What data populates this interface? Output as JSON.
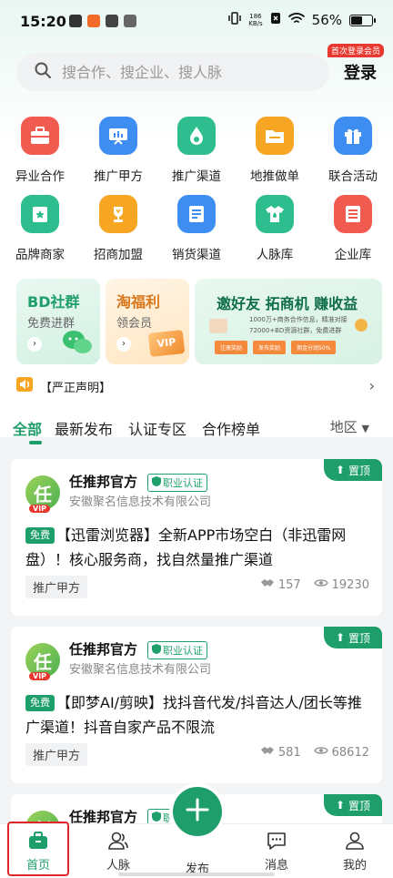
{
  "status_bar": {
    "time": "15:20",
    "net_speed_value": "186",
    "net_speed_unit": "KB/s",
    "battery_text": "56%",
    "battery_level": 0.56
  },
  "search": {
    "placeholder": "搜合作、搜企业、搜人脉",
    "login_label": "登录",
    "login_badge": "首次登录会员"
  },
  "categories": [
    {
      "label": "异业合作",
      "icon": "briefcase-icon",
      "color": "#f05a4f"
    },
    {
      "label": "推广甲方",
      "icon": "chart-board-icon",
      "color": "#3d8ef0"
    },
    {
      "label": "推广渠道",
      "icon": "drop-icon",
      "color": "#2dbd8f"
    },
    {
      "label": "地推做单",
      "icon": "folder-icon",
      "color": "#f7a623"
    },
    {
      "label": "联合活动",
      "icon": "gift-icon",
      "color": "#3d8ef0"
    },
    {
      "label": "品牌商家",
      "icon": "star-badge-icon",
      "color": "#2dbd8f"
    },
    {
      "label": "招商加盟",
      "icon": "trophy-icon",
      "color": "#f7a623"
    },
    {
      "label": "销货渠道",
      "icon": "document-icon",
      "color": "#3d8ef0"
    },
    {
      "label": "人脉库",
      "icon": "shirt-icon",
      "color": "#2dbd8f"
    },
    {
      "label": "企业库",
      "icon": "list-icon",
      "color": "#f05a4f"
    }
  ],
  "promos": {
    "bd": {
      "title": "BD社群",
      "subtitle": "免费进群"
    },
    "taofuli": {
      "title": "淘福利",
      "subtitle": "领会员",
      "vip": "VIP"
    },
    "invite": {
      "title": "邀好友 拓商机 赚收益",
      "line1": "1000万+商务合作信息，精准对接",
      "line2": "72000+BD资源社群，免费进群",
      "steps": [
        "注册奖励",
        "发布奖励",
        "佣金分润50%"
      ]
    }
  },
  "announcement": {
    "text": "【严正声明】"
  },
  "tabs": {
    "items": [
      "全部",
      "最新发布",
      "认证专区",
      "合作榜单"
    ],
    "region": "地区"
  },
  "posts": [
    {
      "pin_label": "置顶",
      "author": "任推邦官方",
      "cert": "职业认证",
      "company": "安徽聚名信息技术有限公司",
      "free_tag": "免费",
      "text": "【迅雷浏览器】全新APP市场空白（非迅雷网盘）！核心服务商，找自然量推广渠道",
      "category": "推广甲方",
      "handshakes": "157",
      "views": "19230",
      "avatar_char": "任",
      "vip": "VIP"
    },
    {
      "pin_label": "置顶",
      "author": "任推邦官方",
      "cert": "职业认证",
      "company": "安徽聚名信息技术有限公司",
      "free_tag": "免费",
      "text": "【即梦AI/剪映】找抖音代发/抖音达人/团长等推广渠道！抖音自家产品不限流",
      "category": "推广甲方",
      "handshakes": "581",
      "views": "68612",
      "avatar_char": "任",
      "vip": "VIP"
    },
    {
      "pin_label": "置顶",
      "author": "任推邦官方",
      "cert": "职业认证",
      "avatar_char": "任"
    }
  ],
  "bottom_nav": {
    "home": "首页",
    "contacts": "人脉",
    "publish": "发布",
    "messages": "消息",
    "mine": "我的"
  },
  "colors": {
    "brand_green": "#1d9e6a",
    "highlight_red": "#e0262a"
  }
}
